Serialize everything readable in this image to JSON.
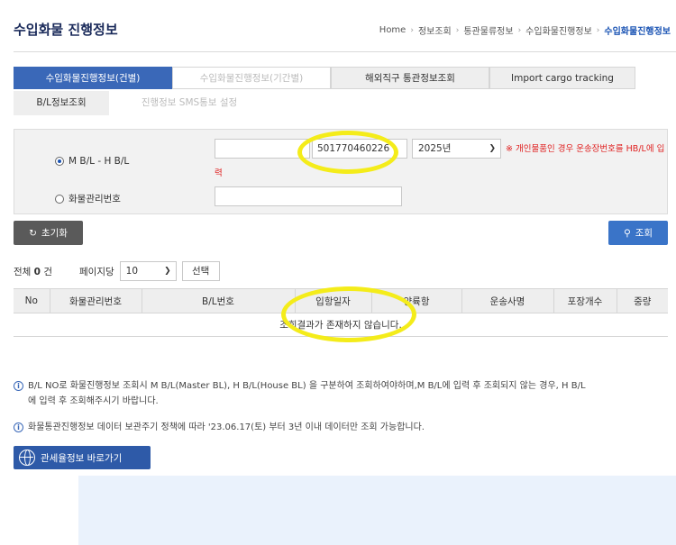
{
  "header": {
    "title": "수입화물 진행정보",
    "breadcrumb": [
      "Home",
      "정보조회",
      "통관물류정보",
      "수입화물진행정보",
      "수입화물진행정보"
    ]
  },
  "tabs": [
    {
      "label": "수입화물진행정보(건별)"
    },
    {
      "label": "수입화물진행정보(기간별)"
    },
    {
      "label": "해외직구 통관정보조회"
    },
    {
      "label": "Import cargo tracking"
    }
  ],
  "subtabs": [
    {
      "label": "B/L정보조회"
    },
    {
      "label": "진행정보 SMS통보 설정"
    }
  ],
  "search": {
    "radio_mbl_label": "M B/L - H B/L",
    "radio_cargo_label": "화물관리번호",
    "mbl_value": "",
    "hbl_value": "501770460226",
    "year_value": "2025년",
    "cargo_value": "",
    "notice_line1": "※ 개인물품인 경우 운송장번호를 HB/L에 입",
    "notice_line2": "력",
    "reset_label": "초기화",
    "search_label": "조회",
    "reset_icon": "refresh-icon",
    "search_icon": "search-icon"
  },
  "results": {
    "total_prefix": "전체",
    "total_count": "0",
    "total_suffix": "건",
    "per_page_label": "페이지당",
    "per_page_value": "10",
    "select_button": "선택",
    "columns": [
      "No",
      "화물관리번호",
      "B/L번호",
      "입항일자",
      "양륙항",
      "운송사명",
      "포장개수",
      "중량"
    ],
    "empty_message": "조회결과가 존재하지 않습니다."
  },
  "info": {
    "line1": "B/L NO로 화물진행정보 조회시 M B/L(Master BL), H B/L(House BL) 을 구분하여 조회하여야하며,M B/L에 입력 후 조회되지 않는 경우, H B/L",
    "line1b": "에 입력 후 조회해주시기 바랍니다.",
    "line2": "화물통관진행정보 데이터 보관주기 정책에 따라 '23.06.17(토) 부터 3년 이내 데이터만 조회 가능합니다.",
    "link_label": "관세율정보 바로가기"
  },
  "colors": {
    "brand_blue": "#3a68b8",
    "notice_red": "#e02020",
    "highlight": "#f4ec1a"
  }
}
